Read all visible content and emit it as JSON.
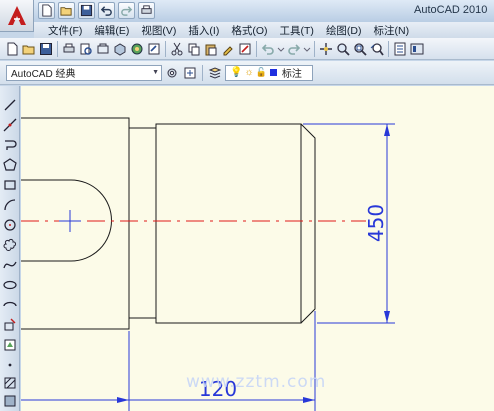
{
  "window": {
    "title": "AutoCAD 2010"
  },
  "quick_access": {
    "icons": [
      "new-icon",
      "open-icon",
      "save-icon",
      "undo-icon",
      "redo-icon",
      "plot-icon"
    ]
  },
  "menu": {
    "items": [
      "文件(F)",
      "编辑(E)",
      "视图(V)",
      "插入(I)",
      "格式(O)",
      "工具(T)",
      "绘图(D)",
      "标注(N)"
    ]
  },
  "toolbar2": {
    "workspace": "AutoCAD 经典",
    "layer": "标注"
  },
  "drawing": {
    "dim_vertical": "450",
    "dim_horizontal": "120",
    "colors": {
      "outline": "#1a1a1a",
      "centerline": "#e01818",
      "dimension": "#2838d8",
      "background": "#fcfbe8"
    }
  },
  "watermark": {
    "text": "www.zztm.com"
  }
}
